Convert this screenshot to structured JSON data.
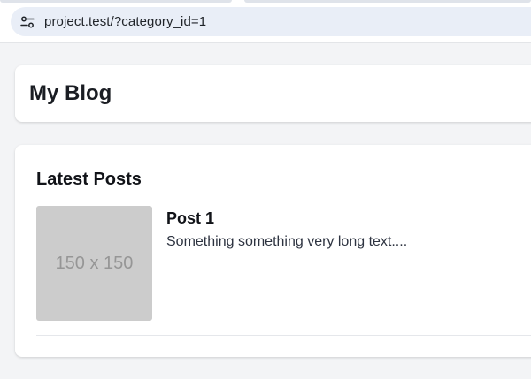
{
  "browser": {
    "url": "project.test/?category_id=1",
    "site_info_icon": "tune-icon"
  },
  "header": {
    "title": "My Blog"
  },
  "posts_section": {
    "title": "Latest Posts",
    "posts": [
      {
        "thumbnail_text": "150 x 150",
        "title": "Post 1",
        "excerpt": "Something something very long text...."
      }
    ]
  }
}
